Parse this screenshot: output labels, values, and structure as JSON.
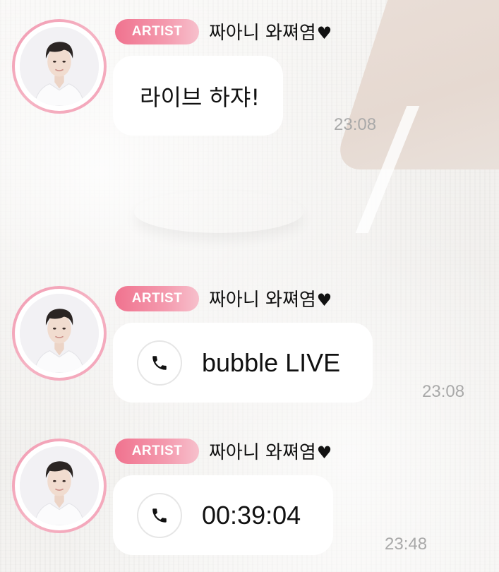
{
  "messages": [
    {
      "badge": "ARTIST",
      "sender": "짜아니 와쪄염",
      "heart": "♥",
      "type": "text",
      "text": "라이브 하쟈!",
      "time": "23:08"
    },
    {
      "badge": "ARTIST",
      "sender": "짜아니 와쪄염",
      "heart": "♥",
      "type": "call",
      "icon": "phone-icon",
      "text": "bubble LIVE",
      "time": "23:08"
    },
    {
      "badge": "ARTIST",
      "sender": "짜아니 와쪄염",
      "heart": "♥",
      "type": "call",
      "icon": "phone-icon",
      "text": "00:39:04",
      "time": "23:48"
    }
  ],
  "colors": {
    "badge_start": "#f0738f",
    "badge_end": "#f7c0cc",
    "avatar_ring": "#f29bb2",
    "time_text": "#a9a9a9",
    "bubble": "#ffffff"
  }
}
